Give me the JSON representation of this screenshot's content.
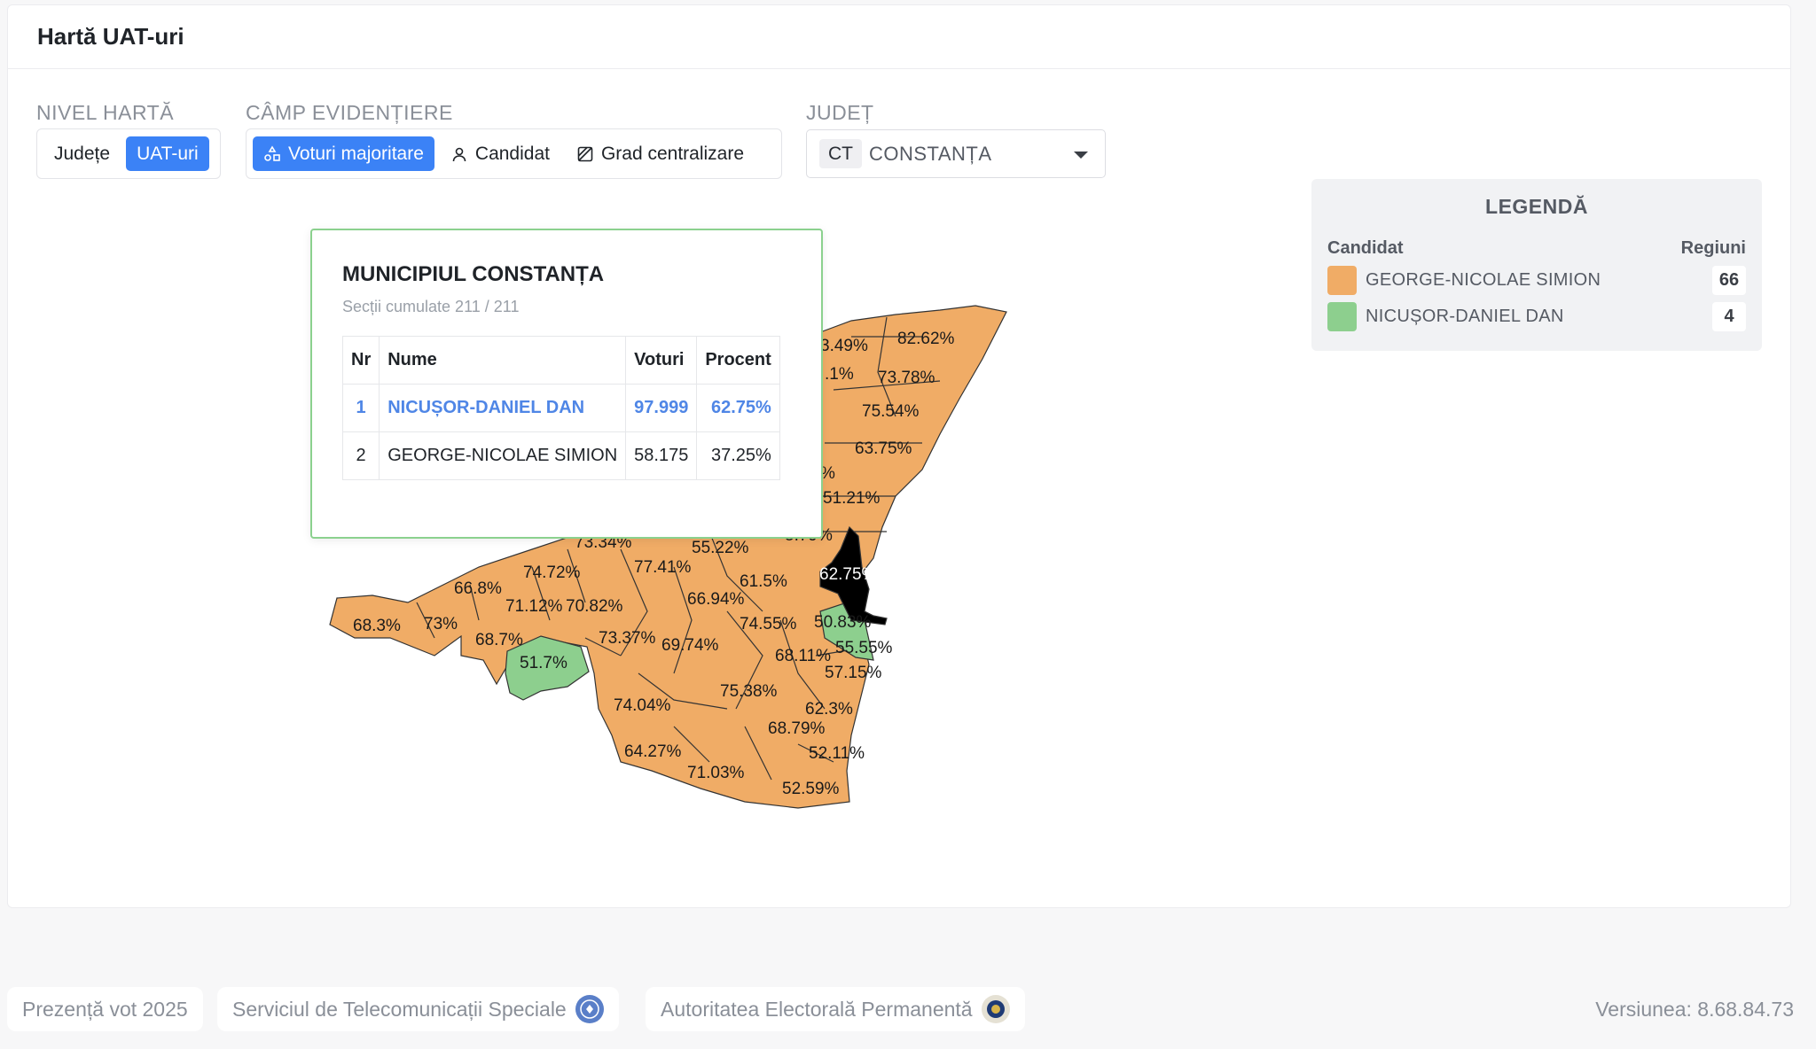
{
  "header": {
    "title": "Hartă UAT-uri"
  },
  "controls": {
    "map_level": {
      "label": "NIVEL HARTĂ",
      "options": [
        "Județe",
        "UAT-uri"
      ],
      "selected": "UAT-uri"
    },
    "highlight_field": {
      "label": "CÂMP EVIDENȚIERE",
      "options": [
        "Voturi majoritare",
        "Candidat",
        "Grad centralizare"
      ],
      "selected": "Voturi majoritare"
    },
    "county": {
      "label": "JUDEȚ",
      "code": "CT",
      "value": "CONSTANȚA"
    }
  },
  "tooltip": {
    "title": "MUNICIPIUL CONSTANȚA",
    "subtitle": "Secții cumulate 211 / 211",
    "columns": [
      "Nr",
      "Nume",
      "Voturi",
      "Procent"
    ],
    "rows": [
      {
        "nr": "1",
        "name": "NICUȘOR-DANIEL DAN",
        "votes": "97.999",
        "percent": "62.75%"
      },
      {
        "nr": "2",
        "name": "GEORGE-NICOLAE SIMION",
        "votes": "58.175",
        "percent": "37.25%"
      }
    ]
  },
  "legend": {
    "title": "LEGENDĂ",
    "col_candidate": "Candidat",
    "col_regions": "Regiuni",
    "items": [
      {
        "name": "GEORGE-NICOLAE SIMION",
        "count": "66",
        "color": "#f0ac66"
      },
      {
        "name": "NICUȘOR-DANIEL DAN",
        "count": "4",
        "color": "#8dcf8e"
      }
    ]
  },
  "map": {
    "colors": {
      "simion": "#f0ac66",
      "dan": "#8dcf8e",
      "selected": "#000000"
    },
    "labels": [
      "3.49%",
      "82.62%",
      ".1%",
      "73.78%",
      "75.54%",
      "63.75%",
      "%",
      "51.21%",
      "73.34%",
      "55.22%",
      "5.79%",
      "62.75%",
      "74.72%",
      "77.41%",
      "66.8%",
      "61.5%",
      "71.12%",
      "70.82%",
      "66.94%",
      "68.3%",
      "73%",
      "74.55%",
      "50.83%",
      "68.7%",
      "73.37%",
      "69.74%",
      "55.55%",
      "51.7%",
      "68.11%",
      "57.15%",
      "75.38%",
      "74.04%",
      "62.3%",
      "68.79%",
      "64.27%",
      "52.11%",
      "71.03%",
      "52.59%"
    ]
  },
  "footer": {
    "items": [
      "Prezență vot 2025",
      "Serviciul de Telecomunicații Speciale",
      "Autoritatea Electorală Permanentă"
    ],
    "version": "Versiunea: 8.68.84.73"
  }
}
